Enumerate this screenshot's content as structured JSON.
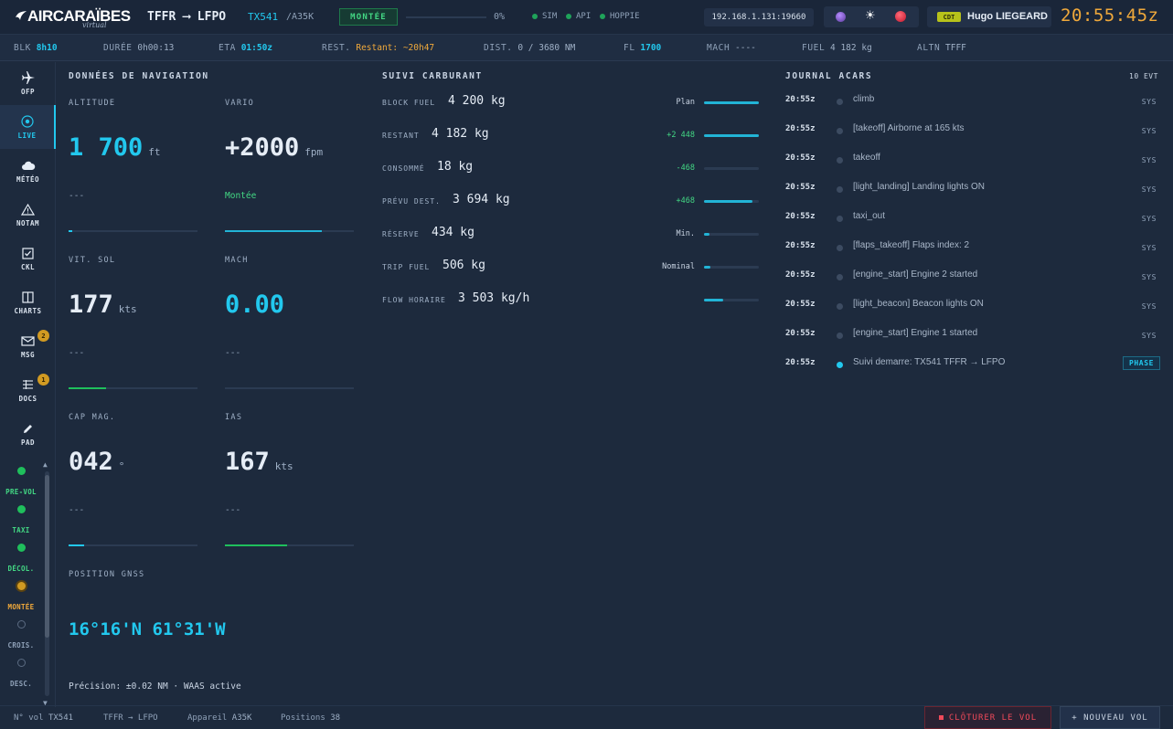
{
  "app": {
    "logo_text": "AIRCARAÏBES",
    "logo_sub": "virtual",
    "route_title": "TFFR ⟶ LFPO",
    "callsign": "TX541",
    "aircraft_type": "/A35K",
    "phase": "MONTÉE",
    "progress_pct": 0,
    "progress_text": "0%",
    "connections": [
      {
        "label": "SIM",
        "status_color": "#1fa35a"
      },
      {
        "label": "API",
        "status_color": "#1fa35a"
      },
      {
        "label": "HOPPIE",
        "status_color": "#1fa35a"
      }
    ],
    "ip": "192.168.1.131:19660",
    "status_icons": [
      "theme-orb-icon",
      "brightness-icon",
      "alert-record-icon"
    ],
    "user": {
      "role": "CDT",
      "name": "Hugo LIEGEARD"
    },
    "clock": "20:55:45z"
  },
  "infostrip": {
    "blk_label": "BLK",
    "blk_value": "8h10",
    "duree_label": "DURÉE",
    "duree_value": "0h00:13",
    "eta_label": "ETA",
    "eta_value": "01:50z",
    "rest_label": "REST.",
    "rest_value": "Restant: ~20h47",
    "dist_label": "DIST.",
    "dist_value": "0 / 3680 NM",
    "fl_label": "FL",
    "fl_value": "1700",
    "mach_label": "MACH",
    "mach_value": "----",
    "fuel_label": "FUEL",
    "fuel_value": "4 182 kg",
    "altn_label": "ALTN",
    "altn_value": "TFFF"
  },
  "sidebar": {
    "items": [
      {
        "label": "OFP",
        "icon": "plane-icon"
      },
      {
        "label": "LIVE",
        "icon": "live-icon",
        "active": true
      },
      {
        "label": "MÉTÉO",
        "icon": "cloud-icon"
      },
      {
        "label": "NOTAM",
        "icon": "warning-icon"
      },
      {
        "label": "CKL",
        "icon": "checklist-icon"
      },
      {
        "label": "CHARTS",
        "icon": "map-icon"
      },
      {
        "label": "MSG",
        "icon": "mail-icon",
        "badge": "2"
      },
      {
        "label": "DOCS",
        "icon": "docs-icon",
        "badge": "1"
      },
      {
        "label": "PAD",
        "icon": "pencil-icon"
      }
    ],
    "phases": [
      {
        "label": "PRE-VOL",
        "state": "done",
        "color": "#43d884"
      },
      {
        "label": "TAXI",
        "state": "done",
        "color": "#43d884"
      },
      {
        "label": "DÉCOL.",
        "state": "done",
        "color": "#43d884"
      },
      {
        "label": "MONTÉE",
        "state": "current",
        "color": "#f0a93b"
      },
      {
        "label": "CROIS.",
        "state": "todo",
        "color": "#8fa1b8"
      },
      {
        "label": "DESC.",
        "state": "todo",
        "color": "#8fa1b8"
      }
    ]
  },
  "navigation": {
    "title": "DONNÉES DE NAVIGATION",
    "altitude": {
      "label": "ALTITUDE",
      "value": "1 700",
      "unit": "ft",
      "sub": "---",
      "bar_pct": 3
    },
    "vario": {
      "label": "VARIO",
      "value": "+2000",
      "unit": "fpm",
      "sub": "Montée",
      "bar_pct": 75
    },
    "vit_sol": {
      "label": "VIT. SOL",
      "value": "177",
      "unit": "kts",
      "sub": "---",
      "bar_pct": 29
    },
    "mach": {
      "label": "MACH",
      "value": "0.00",
      "unit": "",
      "sub": "---",
      "bar_pct": 0
    },
    "cap": {
      "label": "CAP MAG.",
      "value": "042",
      "unit": "°",
      "sub": "---",
      "bar_pct": 12
    },
    "ias": {
      "label": "IAS",
      "value": "167",
      "unit": "kts",
      "sub": "---",
      "bar_pct": 48
    },
    "gnss": {
      "label": "POSITION GNSS",
      "value": "16°16'N 61°31'W",
      "precision": "Précision: ±0.02 NM · WAAS active"
    }
  },
  "fuel": {
    "title": "SUIVI CARBURANT",
    "rows": [
      {
        "label": "BLOCK FUEL",
        "value": "4 200 kg",
        "note": "Plan",
        "note_color": "#c9d4e3",
        "bar_pct": 100
      },
      {
        "label": "RESTANT",
        "value": "4 182 kg",
        "note": "+2 448",
        "note_color": "#43d884",
        "bar_pct": 100
      },
      {
        "label": "CONSOMMÉ",
        "value": "18 kg",
        "note": "-468",
        "note_color": "#43d884",
        "bar_pct": 0
      },
      {
        "label": "PRÉVU DEST.",
        "value": "3 694 kg",
        "note": "+468",
        "note_color": "#43d884",
        "bar_pct": 88
      },
      {
        "label": "RÉSERVE",
        "value": "434 kg",
        "note": "Min.",
        "note_color": "#c9d4e3",
        "bar_pct": 10
      },
      {
        "label": "TRIP FUEL",
        "value": "506 kg",
        "note": "Nominal",
        "note_color": "#c9d4e3",
        "bar_pct": 12
      },
      {
        "label": "FLOW HORAIRE",
        "value": "3 503 kg/h",
        "note": "",
        "note_color": "#c9d4e3",
        "bar_pct": 35
      }
    ]
  },
  "acars": {
    "title": "JOURNAL ACARS",
    "count": "10 EVT",
    "rows": [
      {
        "time": "20:55z",
        "msg": "climb",
        "tag": "SYS"
      },
      {
        "time": "20:55z",
        "msg": "[takeoff] Airborne at 165 kts",
        "tag": "SYS"
      },
      {
        "time": "20:55z",
        "msg": "takeoff",
        "tag": "SYS"
      },
      {
        "time": "20:55z",
        "msg": "[light_landing] Landing lights ON",
        "tag": "SYS"
      },
      {
        "time": "20:55z",
        "msg": "taxi_out",
        "tag": "SYS"
      },
      {
        "time": "20:55z",
        "msg": "[flaps_takeoff] Flaps index: 2",
        "tag": "SYS"
      },
      {
        "time": "20:55z",
        "msg": "[engine_start] Engine 2 started",
        "tag": "SYS"
      },
      {
        "time": "20:55z",
        "msg": "[light_beacon] Beacon lights ON",
        "tag": "SYS"
      },
      {
        "time": "20:55z",
        "msg": "[engine_start] Engine 1 started",
        "tag": "SYS"
      },
      {
        "time": "20:55z",
        "msg": "Suivi demarre: TX541 TFFR → LFPO",
        "tag": "PHASE",
        "live": true
      }
    ]
  },
  "footer": {
    "flight_label": "N° vol",
    "flight_value": "TX541",
    "route": "TFFR → LFPO",
    "aircraft_label": "Appareil",
    "aircraft_value": "A35K",
    "positions_label": "Positions",
    "positions_value": "38",
    "close_label": "CLÔTURER LE VOL",
    "new_label": "+ NOUVEAU VOL"
  },
  "colors": {
    "accent": "#22c8ee",
    "clock": "#f0a93b",
    "success": "#43d884",
    "danger": "#f04a5a"
  }
}
